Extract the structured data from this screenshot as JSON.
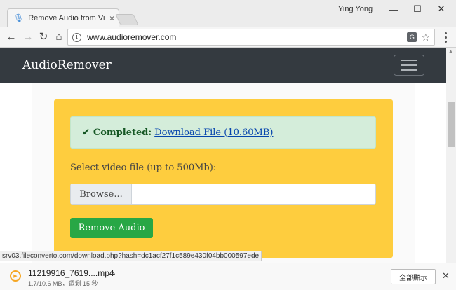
{
  "browser": {
    "tab_title": "Remove Audio from Vi",
    "user_name": "Ying Yong",
    "url": "www.audioremover.com",
    "status_url": "srv03.fileconverto.com/download.php?hash=dc1acf27f1c589e430f04bb000597ede"
  },
  "site": {
    "brand": "AudioRemover"
  },
  "alert": {
    "status": "Completed:",
    "link_text": "Download File (10.60MB)"
  },
  "form": {
    "label": "Select video file (up to 500Mb):",
    "browse_label": "Browse...",
    "submit_label": "Remove Audio"
  },
  "download_shelf": {
    "file_name": "11219916_7619....mp4",
    "status": "1.7/10.6 MB，還剩 15 秒",
    "show_all_label": "全部顯示"
  },
  "colors": {
    "card": "#fecd3e",
    "navbar": "#343a40",
    "alert_bg": "#d4edda",
    "button": "#28a745"
  }
}
